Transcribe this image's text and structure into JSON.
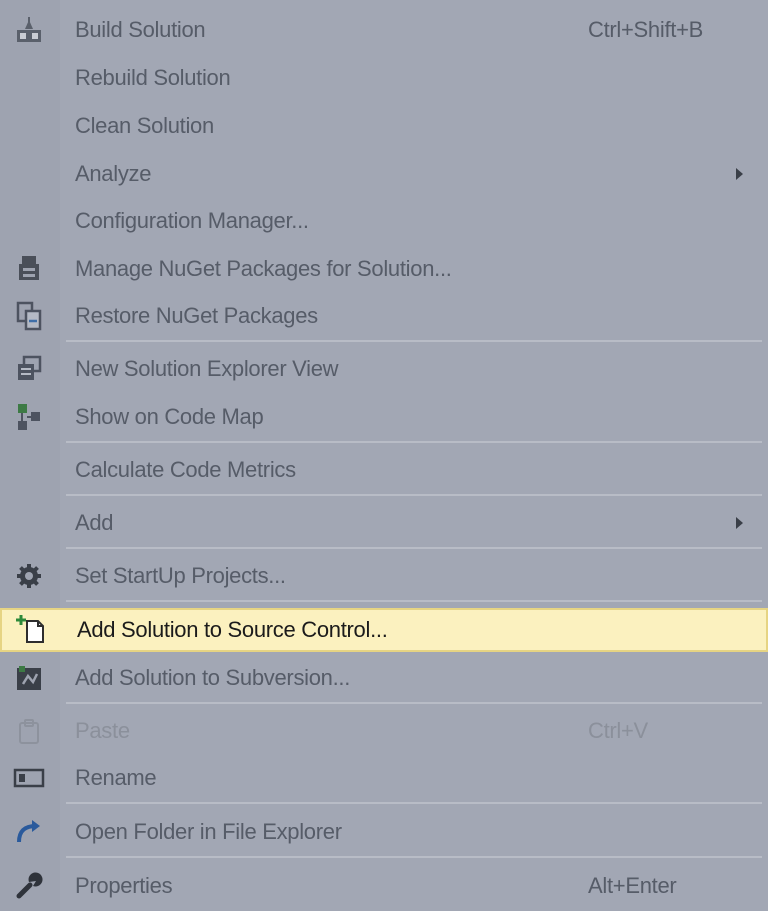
{
  "menu": {
    "items": [
      {
        "label": "Build Solution",
        "shortcut": "Ctrl+Shift+B",
        "icon": "build-icon"
      },
      {
        "label": "Rebuild Solution"
      },
      {
        "label": "Clean Solution"
      },
      {
        "label": "Analyze",
        "submenu": true
      },
      {
        "label": "Configuration Manager..."
      },
      {
        "label": "Manage NuGet Packages for Solution...",
        "icon": "nuget-icon"
      },
      {
        "label": "Restore NuGet Packages",
        "icon": "restore-icon"
      },
      {
        "label": "New Solution Explorer View",
        "icon": "new-view-icon"
      },
      {
        "label": "Show on Code Map",
        "icon": "code-map-icon"
      },
      {
        "label": "Calculate Code Metrics"
      },
      {
        "label": "Add",
        "submenu": true
      },
      {
        "label": "Set StartUp Projects...",
        "icon": "gear-icon"
      },
      {
        "label": "Add Solution to Source Control...",
        "icon": "add-source-control-icon",
        "highlighted": true
      },
      {
        "label": "Add Solution to Subversion...",
        "icon": "subversion-icon"
      },
      {
        "label": "Paste",
        "shortcut": "Ctrl+V",
        "icon": "paste-icon",
        "disabled": true
      },
      {
        "label": "Rename",
        "icon": "rename-icon"
      },
      {
        "label": "Open Folder in File Explorer",
        "icon": "open-folder-icon"
      },
      {
        "label": "Properties",
        "shortcut": "Alt+Enter",
        "icon": "wrench-icon"
      }
    ]
  },
  "colors": {
    "background": "#a2a7b4",
    "highlight": "#fbf1bf",
    "highlight_border": "#e6d483"
  }
}
